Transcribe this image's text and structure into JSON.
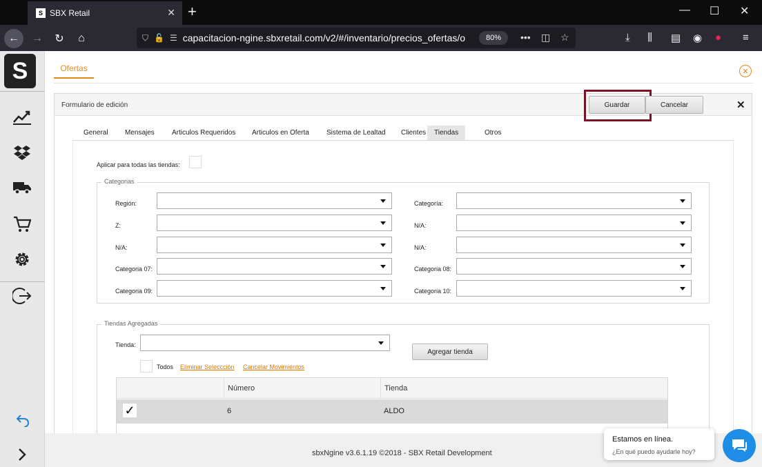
{
  "browser": {
    "tab_title": "SBX Retail",
    "favicon_text": "S",
    "url": "capacitacion-ngine.sbxretail.com/v2/#/inventario/precios_ofertas/o",
    "zoom": "80%"
  },
  "sidebar": {
    "logo_text": "S",
    "icons": [
      "chart-line-icon",
      "dropbox-icon",
      "truck-icon",
      "cart-icon",
      "gear-icon",
      "logout-icon",
      "undo-icon",
      "chevron-right-icon"
    ]
  },
  "page": {
    "tab_label": "Ofertas"
  },
  "form": {
    "title": "Formulario de edición",
    "save_label": "Guardar",
    "cancel_label": "Cancelar",
    "highlight_color": "#7a1326",
    "tabs": [
      "General",
      "Mensajes",
      "Articulos Requeridos",
      "Articulos en Oferta",
      "Sistema de Lealtad",
      "Clientes",
      "Tiendas",
      "Otros"
    ],
    "active_tab": "Tiendas",
    "apply_all_label": "Aplicar para todas las tiendas:",
    "categorias": {
      "legend": "Categorias",
      "left_labels": [
        "Región:",
        "Z:",
        "N/A:",
        "Categoria 07:",
        "Categoria 09:"
      ],
      "right_labels": [
        "Categoría:",
        "N/A:",
        "N/A:",
        "Categoria 08:",
        "Categoria 10:"
      ]
    },
    "tiendas": {
      "legend": "Tiendas Agregadas",
      "tienda_label": "Tienda:",
      "add_button": "Agregar tienda",
      "todos_label": "Todos",
      "eliminar_link": "Eliminar Seleccción",
      "cancelar_link": "Cancelar Movimientos",
      "columns": [
        "",
        "Número",
        "Tienda"
      ],
      "rows": [
        {
          "checked": true,
          "check_glyph": "✓",
          "numero": "6",
          "tienda": "ALDO"
        }
      ]
    }
  },
  "footer": {
    "text": "sbxNgine v3.6.1.19 ©2018 - SBX Retail Development"
  },
  "chat": {
    "title": "Estamos en línea.",
    "subtitle": "¿En qué puedo ayudarle hoy?"
  },
  "colors": {
    "accent": "#e88a1a",
    "chat_blue": "#1f8ce6"
  }
}
